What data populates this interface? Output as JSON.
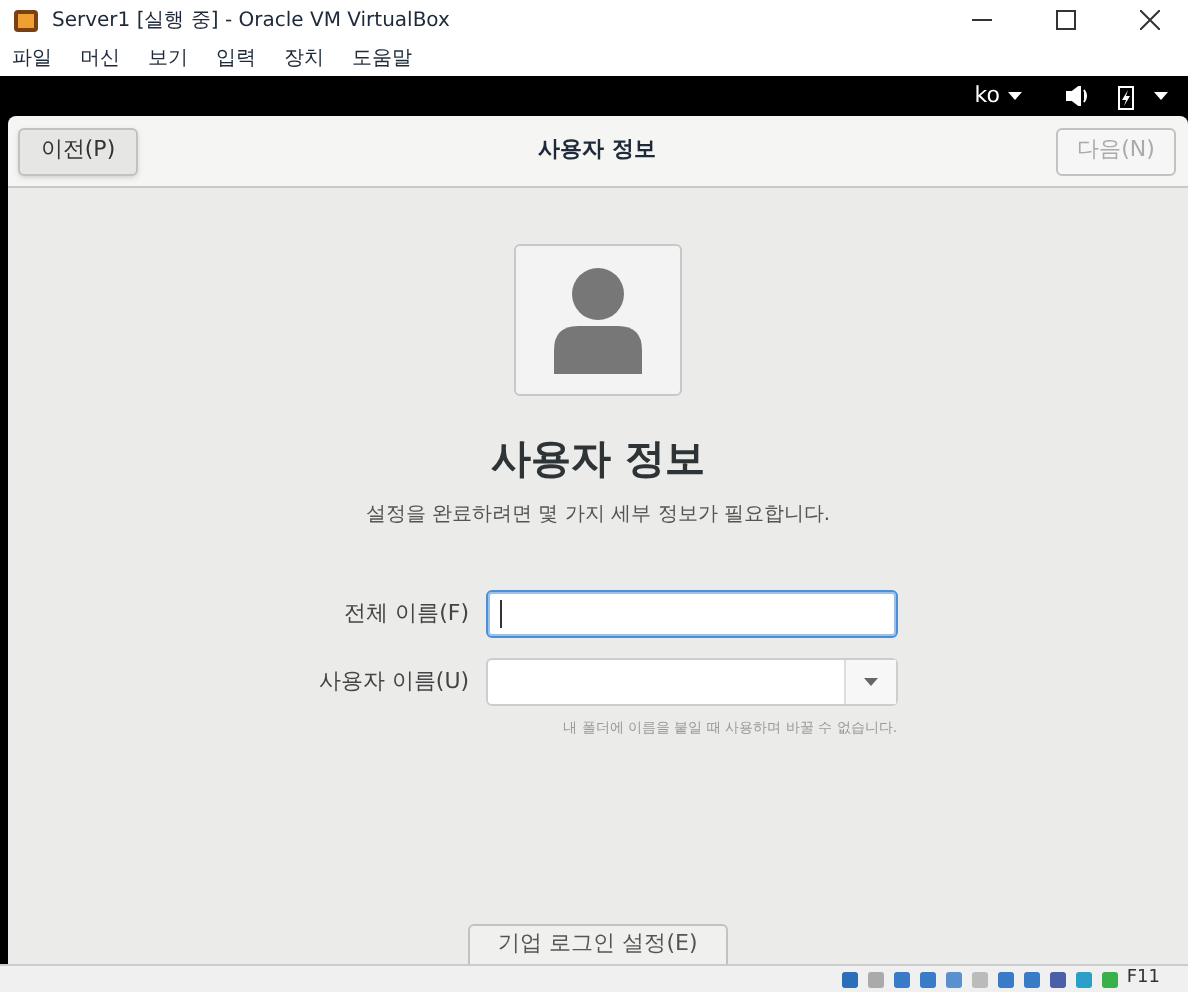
{
  "window": {
    "title": "Server1 [실행 중] - Oracle VM VirtualBox"
  },
  "menu": [
    "파일",
    "머신",
    "보기",
    "입력",
    "장치",
    "도움말"
  ],
  "top_bar": {
    "language": "ko"
  },
  "header": {
    "back_button": {
      "label": "이전(P)",
      "disabled": false
    },
    "title": "사용자 정보",
    "next_button": {
      "label": "다음(N)",
      "disabled": true
    }
  },
  "page": {
    "heading": "사용자 정보",
    "subtitle": "설정을 완료하려면 몇 가지 세부 정보가 필요합니다."
  },
  "fields": [
    {
      "kind": "text",
      "label": "전체 이름(F)",
      "focused": true
    },
    {
      "kind": "combo",
      "label": "사용자 이름(U)",
      "focused": false,
      "hint": "내 폴더에 이름을 붙일 때 사용하며 바꿀 수 없습니다."
    }
  ],
  "enterprise_button": {
    "label": "기업 로그인 설정(E)"
  },
  "status_bar": {
    "host_key": "F11"
  }
}
